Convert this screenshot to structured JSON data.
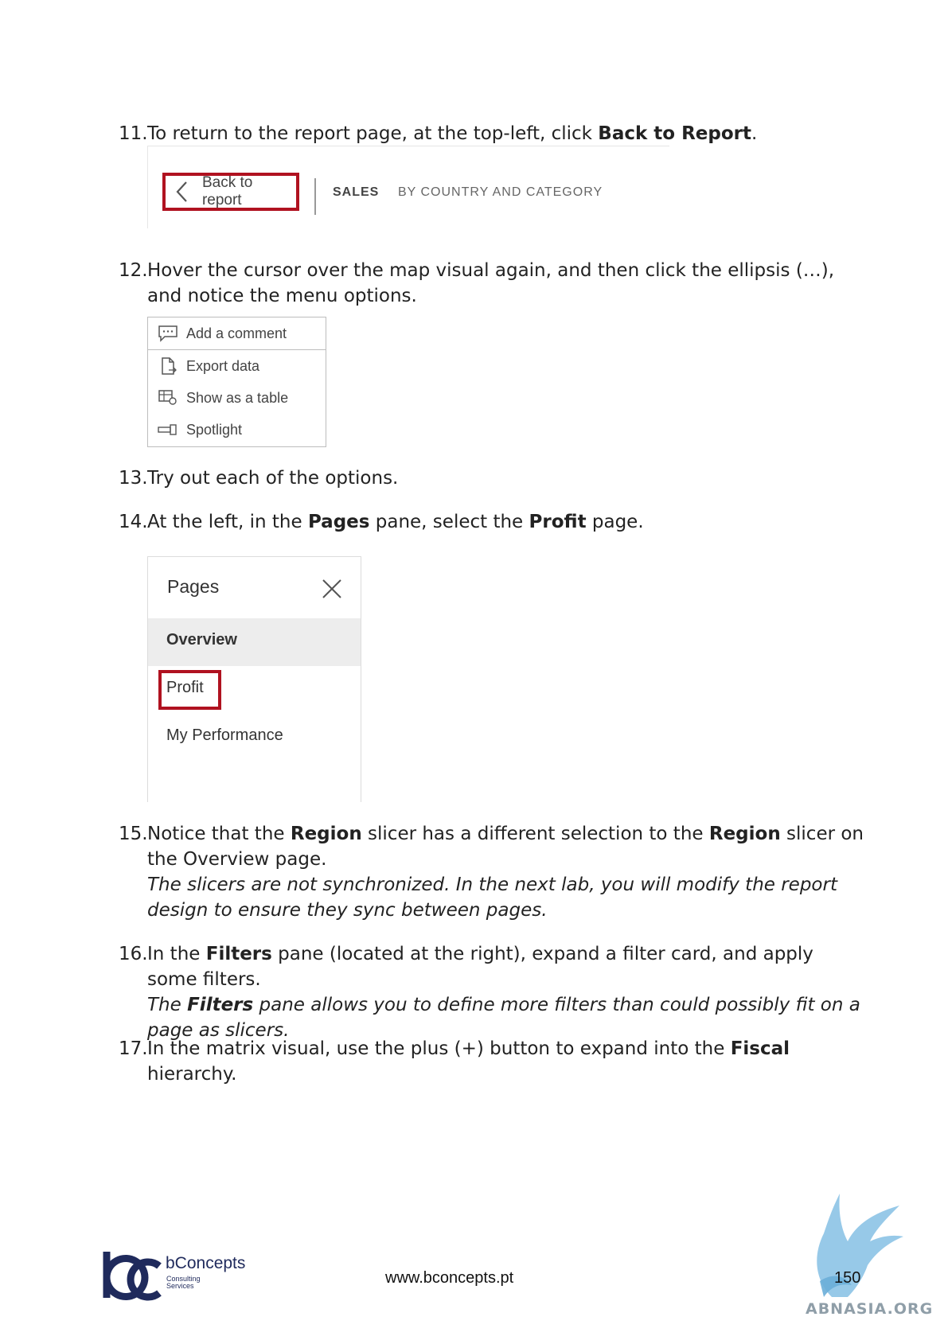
{
  "steps": [
    {
      "num": "11.",
      "text_a": "To return to the report page, at the top-left, click ",
      "bold_a": "Back to Report",
      "text_b": "."
    },
    {
      "num": "12.",
      "text": "Hover the cursor over the map visual again, and then click the ellipsis (…), and notice the menu options."
    },
    {
      "num": "13.",
      "text": "Try out each of the options."
    },
    {
      "num": "14.",
      "text_a": "At the left, in the ",
      "bold_a": "Pages",
      "text_b": " pane, select the ",
      "bold_b": "Profit",
      "text_c": " page."
    },
    {
      "num": "15.",
      "text_a": "Notice that the ",
      "bold_a": "Region",
      "text_b": " slicer has a different selection to the ",
      "bold_b": "Region",
      "text_c": " slicer on the Overview page.",
      "italic": "The slicers are not synchronized. In the next lab, you will modify the report design to ensure they sync between pages."
    },
    {
      "num": "16.",
      "text_a": "In the ",
      "bold_a": "Filters",
      "text_b": " pane (located at the right), expand a filter card, and apply some filters.",
      "italic_a": "The ",
      "italic_bold": "Filters",
      "italic_b": " pane allows you to define more filters than could possibly fit on a page as slicers."
    },
    {
      "num": "17.",
      "text_a": "In the matrix visual, use the plus (+) button to expand into the ",
      "bold_a": "Fiscal",
      "text_b": " hierarchy."
    }
  ],
  "report_bar": {
    "back_label": "Back to report",
    "page_name": "SALES",
    "page_subtitle": "BY COUNTRY AND CATEGORY",
    "highlight_color": "#b01220"
  },
  "context_menu": {
    "items": [
      {
        "label": "Add a comment",
        "icon": "comment-icon"
      },
      {
        "label": "Export data",
        "icon": "export-icon"
      },
      {
        "label": "Show as a table",
        "icon": "table-icon"
      },
      {
        "label": "Spotlight",
        "icon": "spotlight-icon"
      }
    ]
  },
  "pages_pane": {
    "title": "Pages",
    "pages": [
      "Overview",
      "Profit",
      "My Performance"
    ],
    "selected": "Overview",
    "highlighted": "Profit"
  },
  "footer": {
    "brand": "bConcepts",
    "brand_sub_1": "Consulting",
    "brand_sub_2": "Services",
    "url": "www.bconcepts.pt",
    "page_number": "150",
    "watermark": "ABNASIA.ORG",
    "brand_color": "#1f2a5c"
  }
}
